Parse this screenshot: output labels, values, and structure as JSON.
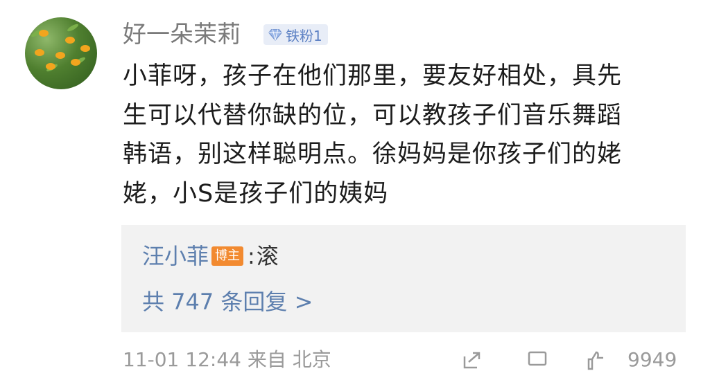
{
  "comment": {
    "author": "好一朵茉莉",
    "badge_text": "铁粉1",
    "lines": [
      "小菲呀，孩子在他们那里，要友好相处，具先",
      "生可以代替你缺的位，可以教孩子们音乐舞蹈",
      "韩语，别这样聪明点。徐妈妈是你孩子们的姥",
      "姥，小S是孩子们的姨妈"
    ]
  },
  "reply": {
    "author": "汪小菲",
    "host_badge": "博主",
    "colon": ":",
    "text": "滚",
    "count_label": "共 747 条回复 >"
  },
  "footer": {
    "meta": "11-01 12:44 来自 北京",
    "count": "9949"
  }
}
